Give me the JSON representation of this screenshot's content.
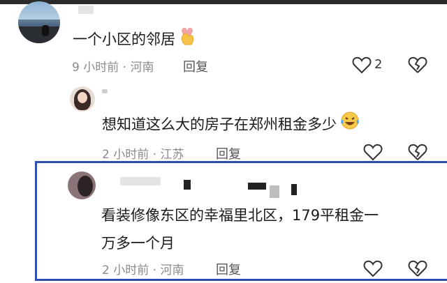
{
  "comments": [
    {
      "text": "一个小区的邻居",
      "time": "9 小时前",
      "separator": "·",
      "location": "河南",
      "reply_label": "回复",
      "like_count": "2"
    },
    {
      "text": "想知道这么大的房子在郑州租金多少",
      "time": "2 小时前",
      "separator": "·",
      "location": "江苏",
      "reply_label": "回复",
      "like_count": ""
    },
    {
      "text_line1": "看装修像东区的幸福里北区，179平租金一",
      "text_line2": "万多一个月",
      "time": "2 小时前",
      "separator": "·",
      "location": "河南",
      "reply_label": "回复",
      "like_count": ""
    }
  ],
  "colors": {
    "highlight_border": "#2f4fb0",
    "meta_text": "#8b8b8b",
    "icon_stroke": "#333333"
  },
  "icons": [
    "heart-outline-icon",
    "broken-heart-icon",
    "finger-heart-emoji",
    "laughing-tears-emoji"
  ]
}
